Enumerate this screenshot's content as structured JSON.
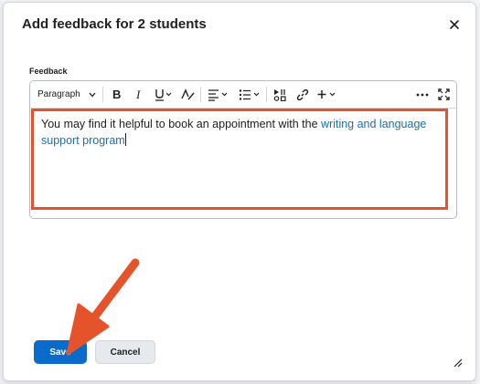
{
  "dialog": {
    "title": "Add feedback for 2 students",
    "close_icon": "close-icon"
  },
  "feedback": {
    "label": "Feedback",
    "toolbar": {
      "format_select": "Paragraph",
      "icons": [
        "chevron-down-icon",
        "bold-icon",
        "italic-icon",
        "underline-icon",
        "text-color-icon",
        "align-icon",
        "list-icon",
        "media-icon",
        "link-icon",
        "insert-plus-icon",
        "more-icon",
        "fullscreen-icon"
      ]
    },
    "content_text": "You may find it helpful to book an appointment with the ",
    "content_link": "writing and language support program"
  },
  "buttons": {
    "save": "Save",
    "cancel": "Cancel"
  },
  "colors": {
    "primary": "#0b6bcb",
    "link": "#1a6fb5",
    "annotation": "#e5532a"
  }
}
